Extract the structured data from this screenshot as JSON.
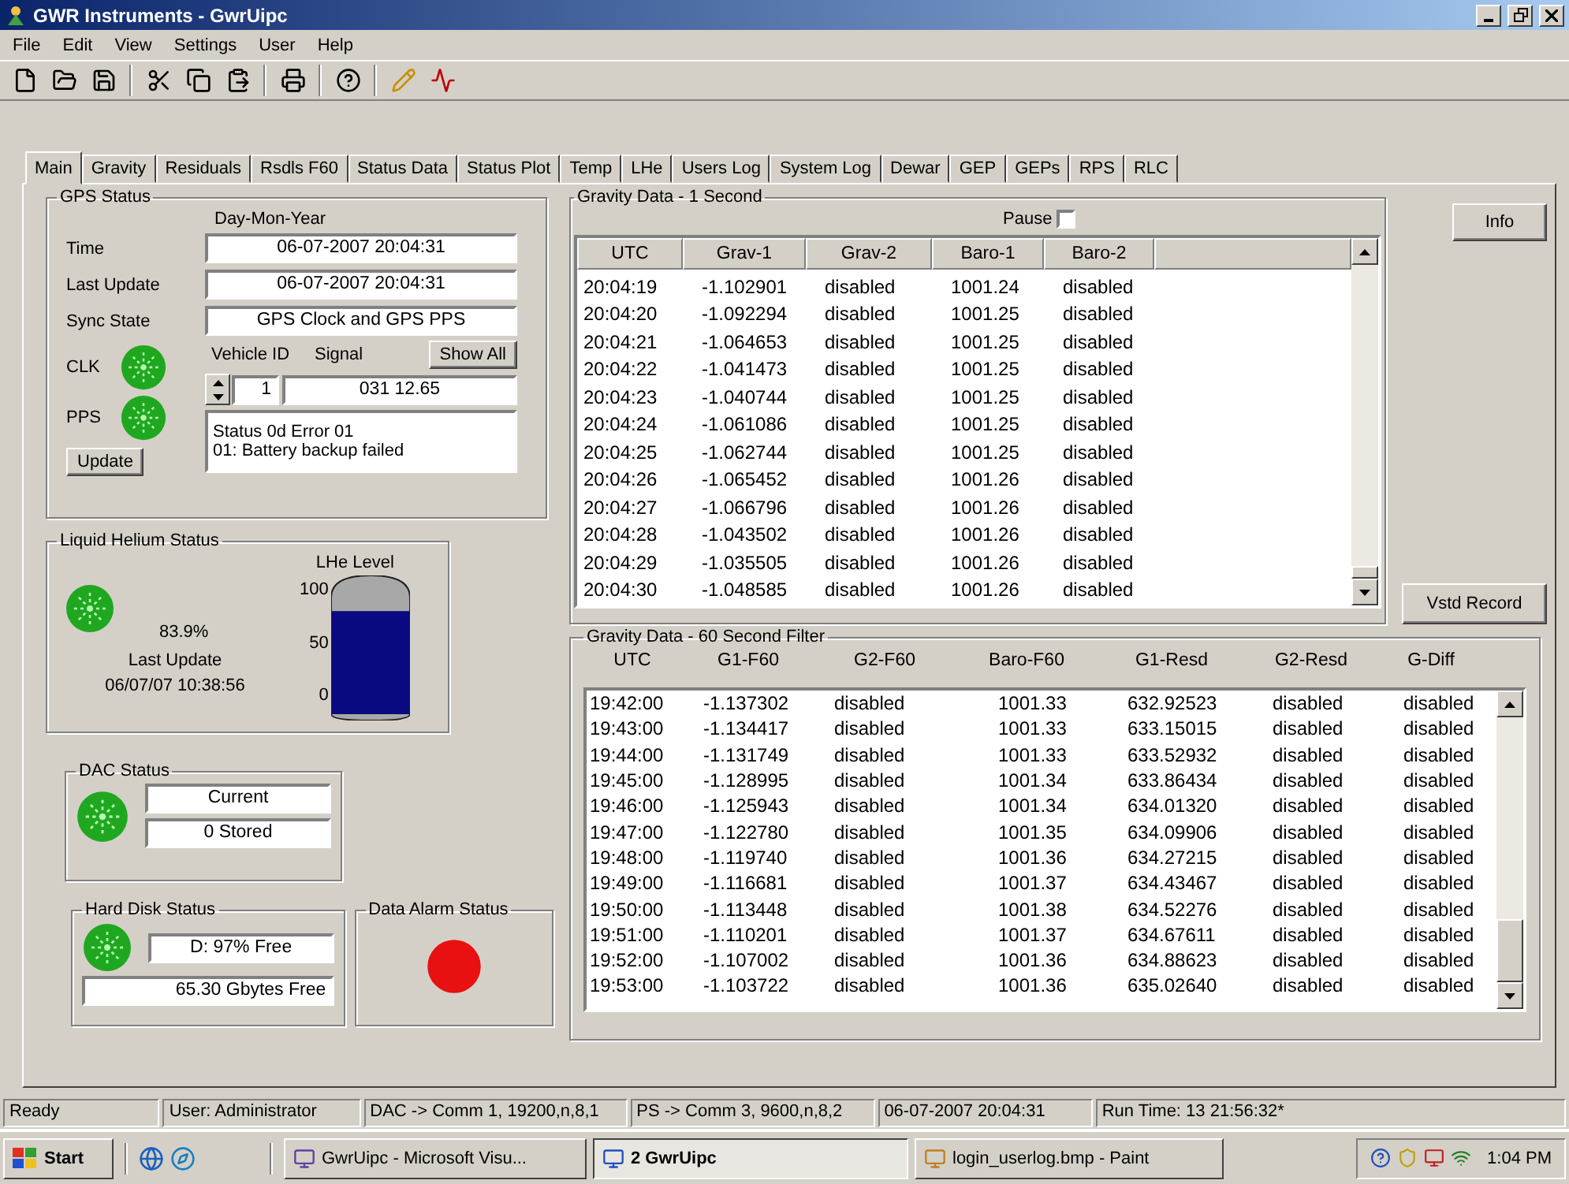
{
  "window": {
    "title": "GWR Instruments - GwrUipc"
  },
  "menu": [
    "File",
    "Edit",
    "View",
    "Settings",
    "User",
    "Help"
  ],
  "tabs": [
    {
      "label": "Main",
      "selected": true
    },
    {
      "label": "Gravity",
      "selected": false
    },
    {
      "label": "Residuals",
      "selected": false
    },
    {
      "label": "Rsdls F60",
      "selected": false
    },
    {
      "label": "Status Data",
      "selected": false
    },
    {
      "label": "Status Plot",
      "selected": false
    },
    {
      "label": "Temp",
      "selected": false
    },
    {
      "label": "LHe",
      "selected": false
    },
    {
      "label": "Users Log",
      "selected": false
    },
    {
      "label": "System Log",
      "selected": false
    },
    {
      "label": "Dewar",
      "selected": false
    },
    {
      "label": "GEP",
      "selected": false
    },
    {
      "label": "GEPs",
      "selected": false
    },
    {
      "label": "RPS",
      "selected": false
    },
    {
      "label": "RLC",
      "selected": false
    }
  ],
  "gps": {
    "title": "GPS Status",
    "format_label": "Day-Mon-Year",
    "fields": [
      {
        "label": "Time",
        "value": "06-07-2007   20:04:31"
      },
      {
        "label": "Last Update",
        "value": "06-07-2007   20:04:31"
      },
      {
        "label": "Sync State",
        "value": "GPS Clock and GPS PPS"
      }
    ],
    "leds": [
      {
        "label": "CLK",
        "color": "#1fa81f"
      },
      {
        "label": "PPS",
        "color": "#1fa81f"
      }
    ],
    "update_button": "Update",
    "vehicle_label": "Vehicle ID",
    "signal_label": "Signal",
    "show_all_button": "Show All",
    "vehicle_value": "1",
    "signal_value": "031   12.65",
    "status_lines": [
      "Status 0d  Error 01",
      "01:   Battery backup failed"
    ]
  },
  "helium": {
    "title": "Liquid Helium Status",
    "color": "#1fa81f",
    "percent": "83.9%",
    "last_update_label": "Last Update",
    "last_update": "06/07/07  10:38:56",
    "gauge": {
      "title": "LHe Level",
      "ticks": [
        "100",
        "50",
        "0"
      ]
    }
  },
  "dac": {
    "title": "DAC Status",
    "color": "#1fa81f",
    "fields": [
      "Current",
      "0 Stored"
    ]
  },
  "disk": {
    "title": "Hard Disk Status",
    "color": "#1fa81f",
    "drive_free": "D:     97% Free",
    "space_free": "65.30 Gbytes Free"
  },
  "alarm": {
    "title": "Data Alarm Status",
    "color": "#e81010"
  },
  "gravity_1s": {
    "title": "Gravity Data - 1 Second",
    "pause_label": "Pause",
    "pause_checked": false,
    "columns": [
      "UTC",
      "Grav-1",
      "Grav-2",
      "Baro-1",
      "Baro-2"
    ],
    "rows": [
      [
        "20:04:19",
        "-1.102901",
        "disabled",
        "1001.24",
        "disabled"
      ],
      [
        "20:04:20",
        "-1.092294",
        "disabled",
        "1001.25",
        "disabled"
      ],
      [
        "20:04:21",
        "-1.064653",
        "disabled",
        "1001.25",
        "disabled"
      ],
      [
        "20:04:22",
        "-1.041473",
        "disabled",
        "1001.25",
        "disabled"
      ],
      [
        "20:04:23",
        "-1.040744",
        "disabled",
        "1001.25",
        "disabled"
      ],
      [
        "20:04:24",
        "-1.061086",
        "disabled",
        "1001.25",
        "disabled"
      ],
      [
        "20:04:25",
        "-1.062744",
        "disabled",
        "1001.25",
        "disabled"
      ],
      [
        "20:04:26",
        "-1.065452",
        "disabled",
        "1001.26",
        "disabled"
      ],
      [
        "20:04:27",
        "-1.066796",
        "disabled",
        "1001.26",
        "disabled"
      ],
      [
        "20:04:28",
        "-1.043502",
        "disabled",
        "1001.26",
        "disabled"
      ],
      [
        "20:04:29",
        "-1.035505",
        "disabled",
        "1001.26",
        "disabled"
      ],
      [
        "20:04:30",
        "-1.048585",
        "disabled",
        "1001.26",
        "disabled"
      ]
    ]
  },
  "info_button": "Info",
  "record_button": "Vstd Record",
  "gravity_60s": {
    "title": "Gravity Data - 60 Second Filter",
    "columns": [
      "UTC",
      "G1-F60",
      "G2-F60",
      "Baro-F60",
      "G1-Resd",
      "G2-Resd",
      "G-Diff"
    ],
    "rows": [
      [
        "19:42:00",
        "-1.137302",
        "disabled",
        "1001.33",
        "632.92523",
        "disabled",
        "disabled"
      ],
      [
        "19:43:00",
        "-1.134417",
        "disabled",
        "1001.33",
        "633.15015",
        "disabled",
        "disabled"
      ],
      [
        "19:44:00",
        "-1.131749",
        "disabled",
        "1001.33",
        "633.52932",
        "disabled",
        "disabled"
      ],
      [
        "19:45:00",
        "-1.128995",
        "disabled",
        "1001.34",
        "633.86434",
        "disabled",
        "disabled"
      ],
      [
        "19:46:00",
        "-1.125943",
        "disabled",
        "1001.34",
        "634.01320",
        "disabled",
        "disabled"
      ],
      [
        "19:47:00",
        "-1.122780",
        "disabled",
        "1001.35",
        "634.09906",
        "disabled",
        "disabled"
      ],
      [
        "19:48:00",
        "-1.119740",
        "disabled",
        "1001.36",
        "634.27215",
        "disabled",
        "disabled"
      ],
      [
        "19:49:00",
        "-1.116681",
        "disabled",
        "1001.37",
        "634.43467",
        "disabled",
        "disabled"
      ],
      [
        "19:50:00",
        "-1.113448",
        "disabled",
        "1001.38",
        "634.52276",
        "disabled",
        "disabled"
      ],
      [
        "19:51:00",
        "-1.110201",
        "disabled",
        "1001.37",
        "634.67611",
        "disabled",
        "disabled"
      ],
      [
        "19:52:00",
        "-1.107002",
        "disabled",
        "1001.36",
        "634.88623",
        "disabled",
        "disabled"
      ],
      [
        "19:53:00",
        "-1.103722",
        "disabled",
        "1001.36",
        "635.02640",
        "disabled",
        "disabled"
      ]
    ]
  },
  "status_bar": [
    "Ready",
    "User: Administrator",
    "DAC -> Comm 1, 19200,n,8,1",
    "PS -> Comm 3, 9600,n,8,2",
    "06-07-2007   20:04:31",
    "Run Time: 13 21:56:32*"
  ],
  "taskbar": {
    "start": "Start",
    "tasks": [
      {
        "label": "GwrUipc - Microsoft Visu...",
        "selected": false
      },
      {
        "label": "2 GwrUipc",
        "selected": true
      },
      {
        "label": "login_userlog.bmp - Paint",
        "selected": false
      }
    ],
    "clock": "1:04 PM"
  }
}
